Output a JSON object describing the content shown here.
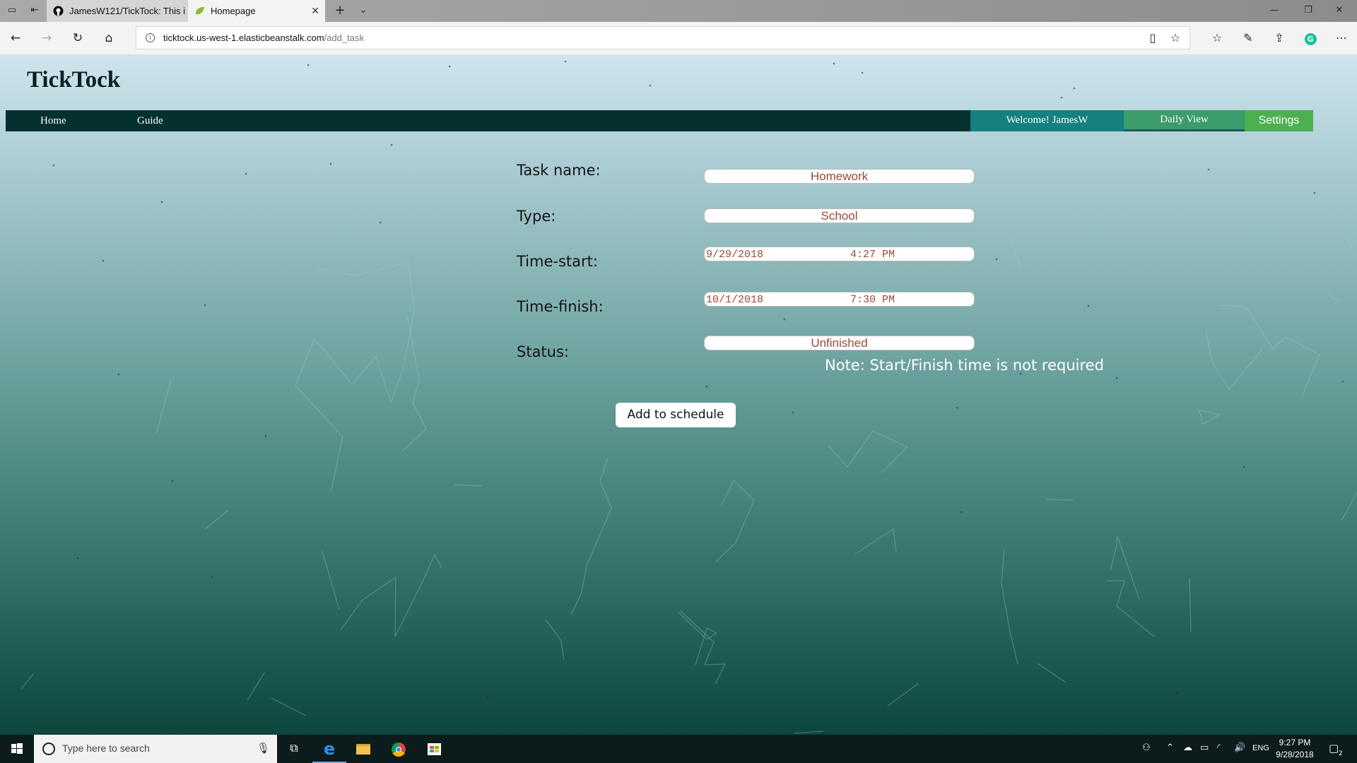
{
  "browser": {
    "tabs": [
      {
        "title": "JamesW121/TickTock: This i",
        "icon": "github-icon",
        "active": false
      },
      {
        "title": "Homepage",
        "icon": "leaf-icon",
        "active": true
      }
    ],
    "url_domain": "ticktock.us-west-1.elasticbeanstalk.com",
    "url_path": "/add_task"
  },
  "site": {
    "title": "TickTock",
    "nav": {
      "home": "Home",
      "guide": "Guide",
      "welcome": "Welcome! JamesW",
      "daily_view": "Daily View",
      "settings": "Settings"
    }
  },
  "form": {
    "task_name": {
      "label": "Task name:",
      "value": "Homework"
    },
    "type": {
      "label": "Type:",
      "value": "School"
    },
    "time_start": {
      "label": "Time-start:",
      "date": "9/29/2018",
      "time": "4:27 PM"
    },
    "time_finish": {
      "label": "Time-finish:",
      "date": "10/1/2018",
      "time": "7:30 PM"
    },
    "status": {
      "label": "Status:",
      "value": "Unfinished"
    },
    "note": "Note: Start/Finish time is not required",
    "submit": "Add to schedule"
  },
  "taskbar": {
    "search_placeholder": "Type here to search",
    "language": "ENG",
    "time": "9:27 PM",
    "date": "9/28/2018",
    "notification_count": "2"
  },
  "colors": {
    "nav_bg": "#04302f",
    "welcome_bg": "#158080",
    "daily_bg": "#3c9c6b",
    "settings_bg": "#4caf50",
    "input_text": "#9a4a35"
  }
}
